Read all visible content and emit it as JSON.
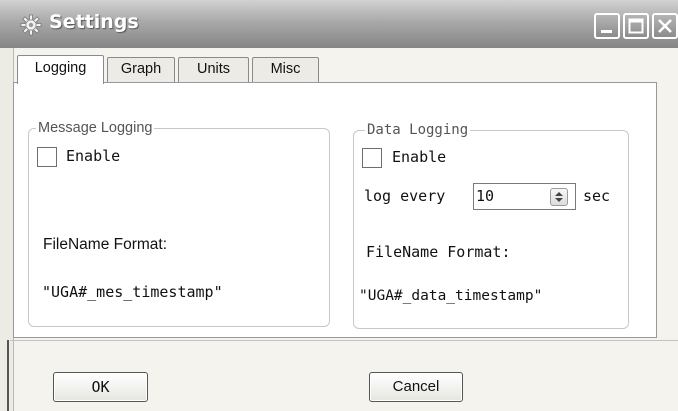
{
  "window": {
    "title": "Settings",
    "icons": [
      "gear-icon",
      "minimize-icon",
      "maximize-icon",
      "close-icon"
    ]
  },
  "tabs": [
    {
      "label": "Logging",
      "active": true
    },
    {
      "label": "Graph",
      "active": false
    },
    {
      "label": "Units",
      "active": false
    },
    {
      "label": "Misc",
      "active": false
    }
  ],
  "message_logging": {
    "legend": "Message Logging",
    "enable_label": "Enable",
    "enable_checked": false,
    "filename_format_label": "FileName Format:",
    "filename_format_value": "\"UGA#_mes_timestamp\""
  },
  "data_logging": {
    "legend": "Data Logging",
    "enable_label": "Enable",
    "enable_checked": false,
    "log_every_label": "log every",
    "log_every_value": "10",
    "log_every_unit": "sec",
    "filename_format_label": "FileName Format:",
    "filename_format_value": "\"UGA#_data_timestamp\""
  },
  "buttons": {
    "ok": "OK",
    "cancel": "Cancel"
  }
}
